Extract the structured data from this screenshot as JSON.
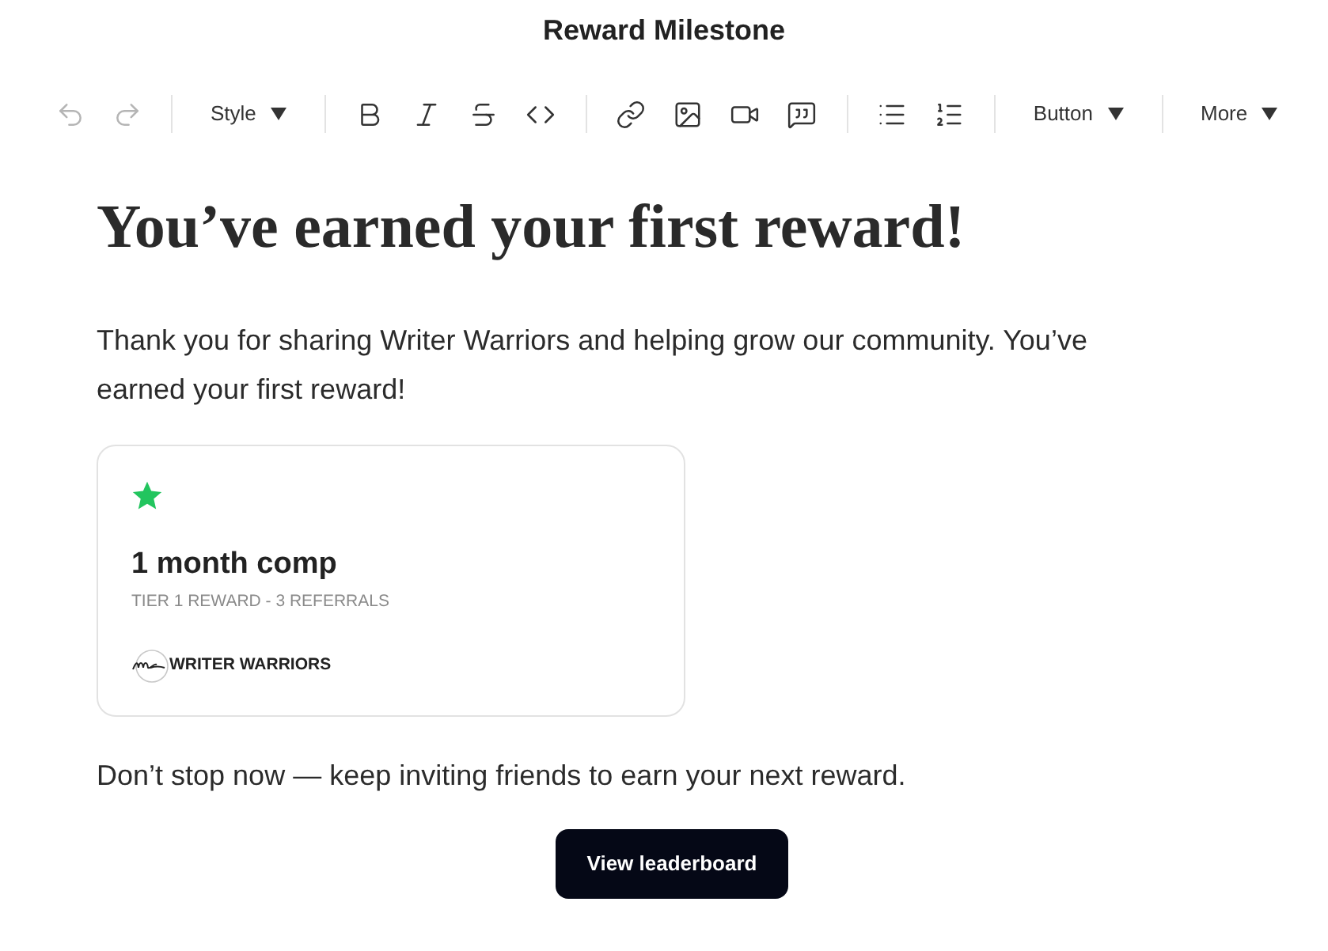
{
  "window": {
    "title": "Reward Milestone"
  },
  "toolbar": [
    {
      "items": [
        {
          "kind": "undo",
          "disabled": true
        },
        {
          "kind": "redo",
          "disabled": true
        }
      ]
    },
    {
      "items": [
        {
          "kind": "dropdown",
          "label": "Style",
          "disabled": false
        }
      ]
    },
    {
      "items": [
        {
          "kind": "bold",
          "disabled": false
        },
        {
          "kind": "italic",
          "disabled": false
        },
        {
          "kind": "strikethrough",
          "disabled": false
        },
        {
          "kind": "code",
          "disabled": false
        }
      ]
    },
    {
      "items": [
        {
          "kind": "link",
          "disabled": false
        },
        {
          "kind": "image",
          "disabled": false
        },
        {
          "kind": "video",
          "disabled": false
        },
        {
          "kind": "quote",
          "disabled": false
        }
      ]
    },
    {
      "items": [
        {
          "kind": "bullet_list",
          "disabled": false
        },
        {
          "kind": "numbered_list",
          "disabled": false
        }
      ]
    },
    {
      "items": [
        {
          "kind": "dropdown",
          "label": "Button",
          "disabled": false
        }
      ]
    },
    {
      "items": [
        {
          "kind": "dropdown",
          "label": "More",
          "disabled": false
        }
      ]
    }
  ],
  "content": {
    "heading": "You’ve earned your first reward!",
    "intro": "Thank you for sharing Writer Warriors and helping grow our community. You’ve earned your first reward!",
    "reward_card": {
      "title": "1 month comp",
      "subtitle": "TIER 1 REWARD - 3 REFERRALS",
      "brand": "WRITER WARRIORS"
    },
    "closing": "Don’t stop now — keep inviting friends to earn your next reward.",
    "button": {
      "label": "View leaderboard"
    }
  }
}
